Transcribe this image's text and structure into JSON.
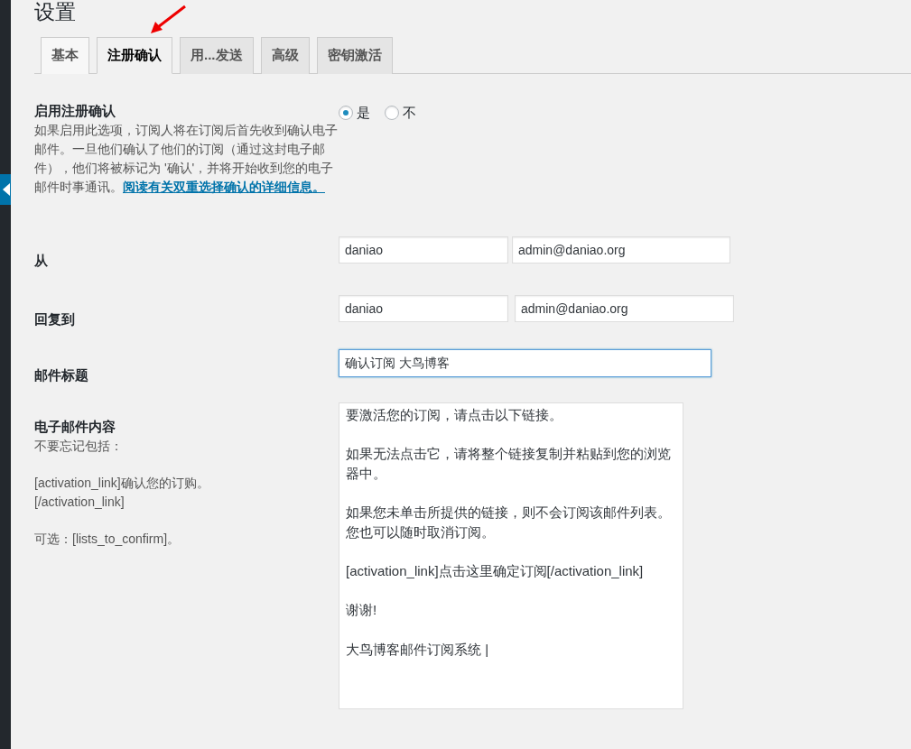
{
  "page_title": "设置",
  "tabs": [
    {
      "label": "基本",
      "selected": false
    },
    {
      "label": "注册确认",
      "selected": true
    },
    {
      "label": "用...发送",
      "selected": false
    },
    {
      "label": "高级",
      "selected": false
    },
    {
      "label": "密钥激活",
      "selected": false
    }
  ],
  "sections": [
    {
      "kind": "radio",
      "label": "启用注册确认",
      "description": "如果启用此选项，订阅人将在订阅后首先收到确认电子邮件。一旦他们确认了他们的订阅（通过这封电子邮件），他们将被标记为 '确认'，并将开始收到您的电子邮件时事通讯。",
      "link": "阅读有关双重选择确认的详细信息。",
      "options": [
        {
          "label": "是",
          "selected": true
        },
        {
          "label": "不",
          "selected": false
        }
      ]
    },
    {
      "kind": "pair",
      "label": "从",
      "name_value": "daniao",
      "email_value": "admin@daniao.org"
    },
    {
      "kind": "pair",
      "label": "回复到",
      "name_value": "daniao",
      "email_value": "admin@daniao.org"
    },
    {
      "kind": "text",
      "label": "邮件标题",
      "value": "确认订阅 大鸟博客",
      "focused": true
    },
    {
      "kind": "textarea",
      "label": "电子邮件内容",
      "help": [
        "不要忘记包括：",
        "[activation_link]确认您的订购。[/activation_link]",
        "可选：[lists_to_confirm]。"
      ],
      "paragraphs": [
        "要激活您的订阅，请点击以下链接。",
        "如果无法点击它，请将整个链接复制并粘贴到您的浏览器中。",
        "如果您未单击所提供的链接，则不会订阅该邮件列表。您也可以随时取消订阅。",
        "[activation_link]点击这里确定订阅[/activation_link]",
        "谢谢!",
        "大鸟博客邮件订阅系统 |"
      ]
    }
  ]
}
